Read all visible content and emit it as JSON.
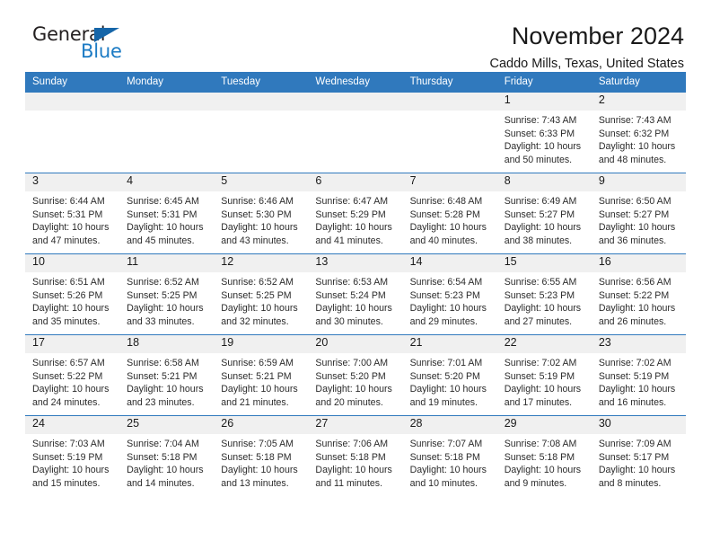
{
  "brand": {
    "name_top": "General",
    "name_bottom": "Blue",
    "accent_color": "#1c7bc4",
    "triangle_color": "#1565a8"
  },
  "header": {
    "title": "November 2024",
    "subtitle": "Caddo Mills, Texas, United States"
  },
  "calendar": {
    "header_bg": "#3079bd",
    "daynum_bg": "#f0f0f0",
    "weekday_headers": [
      "Sunday",
      "Monday",
      "Tuesday",
      "Wednesday",
      "Thursday",
      "Friday",
      "Saturday"
    ],
    "weeks": [
      [
        {
          "blank": true
        },
        {
          "blank": true
        },
        {
          "blank": true
        },
        {
          "blank": true
        },
        {
          "blank": true
        },
        {
          "day": "1",
          "sunrise": "Sunrise: 7:43 AM",
          "sunset": "Sunset: 6:33 PM",
          "daylight_1": "Daylight: 10 hours",
          "daylight_2": "and 50 minutes."
        },
        {
          "day": "2",
          "sunrise": "Sunrise: 7:43 AM",
          "sunset": "Sunset: 6:32 PM",
          "daylight_1": "Daylight: 10 hours",
          "daylight_2": "and 48 minutes."
        }
      ],
      [
        {
          "day": "3",
          "sunrise": "Sunrise: 6:44 AM",
          "sunset": "Sunset: 5:31 PM",
          "daylight_1": "Daylight: 10 hours",
          "daylight_2": "and 47 minutes."
        },
        {
          "day": "4",
          "sunrise": "Sunrise: 6:45 AM",
          "sunset": "Sunset: 5:31 PM",
          "daylight_1": "Daylight: 10 hours",
          "daylight_2": "and 45 minutes."
        },
        {
          "day": "5",
          "sunrise": "Sunrise: 6:46 AM",
          "sunset": "Sunset: 5:30 PM",
          "daylight_1": "Daylight: 10 hours",
          "daylight_2": "and 43 minutes."
        },
        {
          "day": "6",
          "sunrise": "Sunrise: 6:47 AM",
          "sunset": "Sunset: 5:29 PM",
          "daylight_1": "Daylight: 10 hours",
          "daylight_2": "and 41 minutes."
        },
        {
          "day": "7",
          "sunrise": "Sunrise: 6:48 AM",
          "sunset": "Sunset: 5:28 PM",
          "daylight_1": "Daylight: 10 hours",
          "daylight_2": "and 40 minutes."
        },
        {
          "day": "8",
          "sunrise": "Sunrise: 6:49 AM",
          "sunset": "Sunset: 5:27 PM",
          "daylight_1": "Daylight: 10 hours",
          "daylight_2": "and 38 minutes."
        },
        {
          "day": "9",
          "sunrise": "Sunrise: 6:50 AM",
          "sunset": "Sunset: 5:27 PM",
          "daylight_1": "Daylight: 10 hours",
          "daylight_2": "and 36 minutes."
        }
      ],
      [
        {
          "day": "10",
          "sunrise": "Sunrise: 6:51 AM",
          "sunset": "Sunset: 5:26 PM",
          "daylight_1": "Daylight: 10 hours",
          "daylight_2": "and 35 minutes."
        },
        {
          "day": "11",
          "sunrise": "Sunrise: 6:52 AM",
          "sunset": "Sunset: 5:25 PM",
          "daylight_1": "Daylight: 10 hours",
          "daylight_2": "and 33 minutes."
        },
        {
          "day": "12",
          "sunrise": "Sunrise: 6:52 AM",
          "sunset": "Sunset: 5:25 PM",
          "daylight_1": "Daylight: 10 hours",
          "daylight_2": "and 32 minutes."
        },
        {
          "day": "13",
          "sunrise": "Sunrise: 6:53 AM",
          "sunset": "Sunset: 5:24 PM",
          "daylight_1": "Daylight: 10 hours",
          "daylight_2": "and 30 minutes."
        },
        {
          "day": "14",
          "sunrise": "Sunrise: 6:54 AM",
          "sunset": "Sunset: 5:23 PM",
          "daylight_1": "Daylight: 10 hours",
          "daylight_2": "and 29 minutes."
        },
        {
          "day": "15",
          "sunrise": "Sunrise: 6:55 AM",
          "sunset": "Sunset: 5:23 PM",
          "daylight_1": "Daylight: 10 hours",
          "daylight_2": "and 27 minutes."
        },
        {
          "day": "16",
          "sunrise": "Sunrise: 6:56 AM",
          "sunset": "Sunset: 5:22 PM",
          "daylight_1": "Daylight: 10 hours",
          "daylight_2": "and 26 minutes."
        }
      ],
      [
        {
          "day": "17",
          "sunrise": "Sunrise: 6:57 AM",
          "sunset": "Sunset: 5:22 PM",
          "daylight_1": "Daylight: 10 hours",
          "daylight_2": "and 24 minutes."
        },
        {
          "day": "18",
          "sunrise": "Sunrise: 6:58 AM",
          "sunset": "Sunset: 5:21 PM",
          "daylight_1": "Daylight: 10 hours",
          "daylight_2": "and 23 minutes."
        },
        {
          "day": "19",
          "sunrise": "Sunrise: 6:59 AM",
          "sunset": "Sunset: 5:21 PM",
          "daylight_1": "Daylight: 10 hours",
          "daylight_2": "and 21 minutes."
        },
        {
          "day": "20",
          "sunrise": "Sunrise: 7:00 AM",
          "sunset": "Sunset: 5:20 PM",
          "daylight_1": "Daylight: 10 hours",
          "daylight_2": "and 20 minutes."
        },
        {
          "day": "21",
          "sunrise": "Sunrise: 7:01 AM",
          "sunset": "Sunset: 5:20 PM",
          "daylight_1": "Daylight: 10 hours",
          "daylight_2": "and 19 minutes."
        },
        {
          "day": "22",
          "sunrise": "Sunrise: 7:02 AM",
          "sunset": "Sunset: 5:19 PM",
          "daylight_1": "Daylight: 10 hours",
          "daylight_2": "and 17 minutes."
        },
        {
          "day": "23",
          "sunrise": "Sunrise: 7:02 AM",
          "sunset": "Sunset: 5:19 PM",
          "daylight_1": "Daylight: 10 hours",
          "daylight_2": "and 16 minutes."
        }
      ],
      [
        {
          "day": "24",
          "sunrise": "Sunrise: 7:03 AM",
          "sunset": "Sunset: 5:19 PM",
          "daylight_1": "Daylight: 10 hours",
          "daylight_2": "and 15 minutes."
        },
        {
          "day": "25",
          "sunrise": "Sunrise: 7:04 AM",
          "sunset": "Sunset: 5:18 PM",
          "daylight_1": "Daylight: 10 hours",
          "daylight_2": "and 14 minutes."
        },
        {
          "day": "26",
          "sunrise": "Sunrise: 7:05 AM",
          "sunset": "Sunset: 5:18 PM",
          "daylight_1": "Daylight: 10 hours",
          "daylight_2": "and 13 minutes."
        },
        {
          "day": "27",
          "sunrise": "Sunrise: 7:06 AM",
          "sunset": "Sunset: 5:18 PM",
          "daylight_1": "Daylight: 10 hours",
          "daylight_2": "and 11 minutes."
        },
        {
          "day": "28",
          "sunrise": "Sunrise: 7:07 AM",
          "sunset": "Sunset: 5:18 PM",
          "daylight_1": "Daylight: 10 hours",
          "daylight_2": "and 10 minutes."
        },
        {
          "day": "29",
          "sunrise": "Sunrise: 7:08 AM",
          "sunset": "Sunset: 5:18 PM",
          "daylight_1": "Daylight: 10 hours",
          "daylight_2": "and 9 minutes."
        },
        {
          "day": "30",
          "sunrise": "Sunrise: 7:09 AM",
          "sunset": "Sunset: 5:17 PM",
          "daylight_1": "Daylight: 10 hours",
          "daylight_2": "and 8 minutes."
        }
      ]
    ]
  }
}
